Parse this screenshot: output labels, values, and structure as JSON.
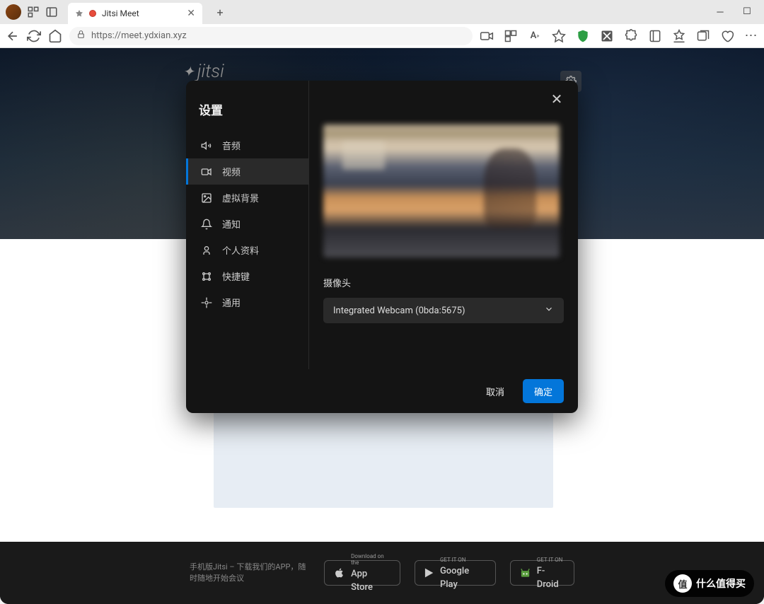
{
  "browser": {
    "tab_title": "Jitsi Meet",
    "url": "https://meet.ydxian.xyz"
  },
  "app": {
    "logo_text": "jitsi"
  },
  "modal": {
    "title": "设置",
    "sidebar": {
      "audio": "音频",
      "video": "视频",
      "virtual_bg": "虚拟背景",
      "notifications": "通知",
      "profile": "个人资料",
      "shortcuts": "快捷键",
      "general": "通用"
    },
    "camera_label": "摄像头",
    "camera_value": "Integrated Webcam (0bda:5675)",
    "cancel": "取消",
    "ok": "确定"
  },
  "footer": {
    "text": "手机版Jitsi – 下载我们的APP，随时随地开始会议",
    "appstore_small": "Download on the",
    "appstore": "App Store",
    "play_small": "GET IT ON",
    "play": "Google Play",
    "fdroid_small": "GET IT ON",
    "fdroid": "F-Droid"
  },
  "badge": {
    "circle": "值",
    "text": "什么值得买"
  }
}
